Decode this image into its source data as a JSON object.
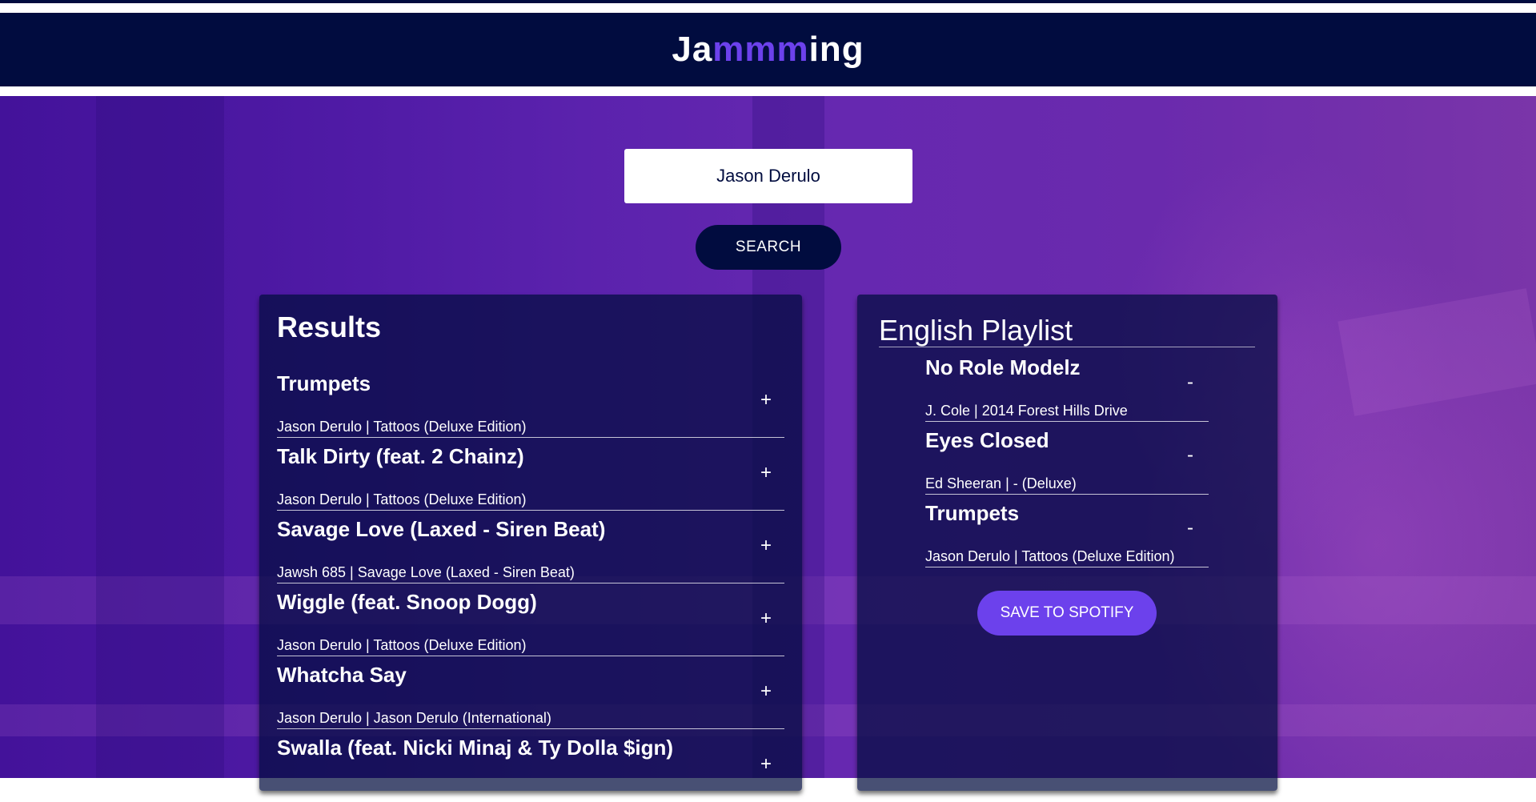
{
  "header": {
    "title_start": "Ja",
    "title_accent": "mmm",
    "title_end": "ing"
  },
  "search": {
    "value": "Jason Derulo",
    "button_label": "SEARCH"
  },
  "results": {
    "heading": "Results",
    "add_symbol": "+",
    "tracks": [
      {
        "name": "Trumpets",
        "info": "Jason Derulo | Tattoos (Deluxe Edition)"
      },
      {
        "name": "Talk Dirty (feat. 2 Chainz)",
        "info": "Jason Derulo | Tattoos (Deluxe Edition)"
      },
      {
        "name": "Savage Love (Laxed - Siren Beat)",
        "info": "Jawsh 685 | Savage Love (Laxed - Siren Beat)"
      },
      {
        "name": "Wiggle (feat. Snoop Dogg)",
        "info": "Jason Derulo | Tattoos (Deluxe Edition)"
      },
      {
        "name": "Whatcha Say",
        "info": "Jason Derulo | Jason Derulo (International)"
      },
      {
        "name": "Swalla (feat. Nicki Minaj & Ty Dolla $ign)",
        "info": ""
      }
    ]
  },
  "playlist": {
    "name": "English Playlist",
    "remove_symbol": "-",
    "tracks": [
      {
        "name": "No Role Modelz",
        "info": "J. Cole | 2014 Forest Hills Drive"
      },
      {
        "name": "Eyes Closed",
        "info": "Ed Sheeran | - (Deluxe)"
      },
      {
        "name": "Trumpets",
        "info": "Jason Derulo | Tattoos (Deluxe Edition)"
      }
    ],
    "save_label": "SAVE TO SPOTIFY"
  },
  "colors": {
    "header_bg": "#010c3f",
    "accent": "#6c41ec",
    "panel_bg": "rgba(1,12,63,0.72)"
  }
}
